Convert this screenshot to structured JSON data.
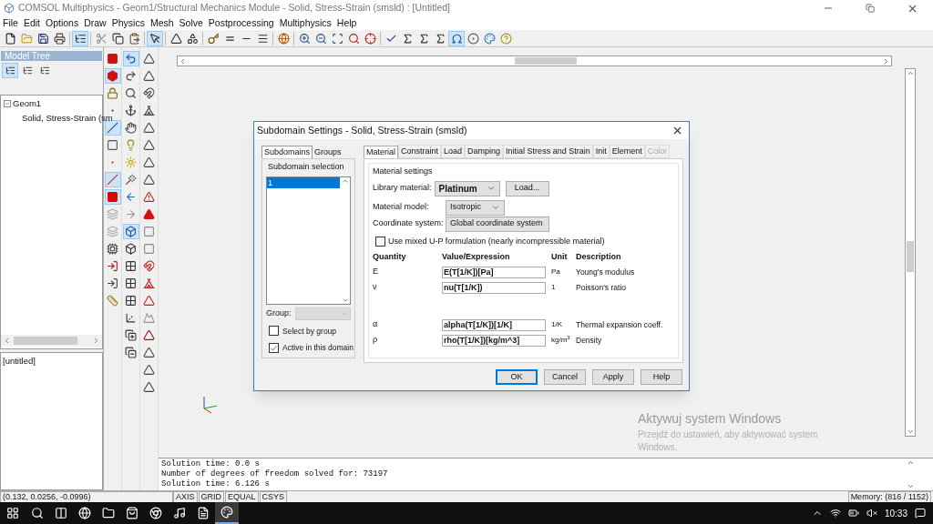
{
  "window": {
    "title": "COMSOL Multiphysics - Geom1/Structural Mechanics Module - Solid, Stress-Strain (smsld) : [Untitled]"
  },
  "menu": [
    "File",
    "Edit",
    "Options",
    "Draw",
    "Physics",
    "Mesh",
    "Solve",
    "Postprocessing",
    "Multiphysics",
    "Help"
  ],
  "toolbar": [
    {
      "selected": false
    },
    {
      "selected": false
    },
    {
      "selected": false
    },
    {
      "selected": false
    },
    {
      "selected": true
    },
    {
      "selected": false
    },
    {
      "selected": false
    },
    {
      "selected": false
    },
    {
      "selected": true
    },
    {
      "selected": false
    },
    {
      "selected": false
    },
    {
      "selected": false
    },
    {
      "selected": false
    },
    {
      "selected": false
    },
    {
      "selected": false
    },
    {
      "selected": false
    },
    {
      "selected": false
    },
    {
      "selected": false
    },
    {
      "selected": false
    },
    {
      "selected": false
    },
    {
      "selected": false
    },
    {
      "selected": false
    },
    {
      "selected": false
    },
    {
      "selected": false
    },
    {
      "selected": false
    },
    {
      "selected": true
    },
    {
      "selected": false
    },
    {
      "selected": false
    },
    {
      "selected": false
    }
  ],
  "model_tree": {
    "title": "Model Tree",
    "tools": [
      {
        "selected": true
      },
      {
        "selected": false
      },
      {
        "selected": false
      }
    ],
    "items": [
      {
        "label": "Geom1",
        "expanded": true,
        "children": [
          {
            "label": "Solid, Stress-Strain (sm"
          }
        ]
      }
    ]
  },
  "notes_panel": {
    "text": "[untitled]"
  },
  "side_toolbars": [
    [
      {
        "selected": false
      },
      {
        "selected": true
      },
      {
        "selected": false
      },
      {
        "selected": false
      },
      {
        "selected": true
      },
      {
        "selected": false
      },
      {
        "selected": false
      },
      {
        "selected": true
      },
      {
        "selected": true
      },
      {
        "selected": false
      },
      {
        "selected": false
      },
      {
        "selected": false
      },
      {
        "selected": false
      },
      {
        "selected": false
      },
      {
        "selected": false
      }
    ],
    [
      {
        "selected": true
      },
      {
        "selected": false
      },
      {
        "selected": false
      },
      {
        "selected": false
      },
      {
        "selected": false
      },
      {
        "selected": false
      },
      {
        "selected": false
      },
      {
        "selected": false
      },
      {
        "selected": false
      },
      {
        "selected": false
      },
      {
        "selected": true
      },
      {
        "selected": false
      },
      {
        "selected": false
      },
      {
        "selected": false
      },
      {
        "selected": false
      },
      {
        "selected": false
      },
      {
        "selected": false
      },
      {
        "selected": false
      }
    ],
    [
      {
        "selected": false
      },
      {
        "selected": false
      },
      {
        "selected": false
      },
      {
        "selected": false
      },
      {
        "selected": false
      },
      {
        "selected": false
      },
      {
        "selected": false
      },
      {
        "selected": false
      },
      {
        "selected": false
      },
      {
        "selected": false
      },
      {
        "selected": false
      },
      {
        "selected": false
      },
      {
        "selected": false
      },
      {
        "selected": false
      },
      {
        "selected": false
      },
      {
        "selected": false
      },
      {
        "selected": false
      },
      {
        "selected": false
      },
      {
        "selected": false
      },
      {
        "selected": false
      }
    ]
  ],
  "dialog": {
    "title": "Subdomain Settings - Solid, Stress-Strain (smsld)",
    "side_tabs": [
      {
        "label": "Subdomains",
        "selected": true
      },
      {
        "label": "Groups",
        "selected": false
      }
    ],
    "subdomain_selection": {
      "title": "Subdomain selection",
      "items": [
        {
          "label": "1",
          "selected": true
        }
      ]
    },
    "group_label": "Group:",
    "checkboxes": [
      {
        "label": "Select by group",
        "checked": false
      },
      {
        "label": "Active in this domain",
        "checked": true
      }
    ],
    "tabs": [
      {
        "label": "Material",
        "selected": true,
        "disabled": false
      },
      {
        "label": "Constraint",
        "selected": false,
        "disabled": false
      },
      {
        "label": "Load",
        "selected": false,
        "disabled": false
      },
      {
        "label": "Damping",
        "selected": false,
        "disabled": false
      },
      {
        "label": "Initial Stress and Strain",
        "selected": false,
        "disabled": false
      },
      {
        "label": "Init",
        "selected": false,
        "disabled": false
      },
      {
        "label": "Element",
        "selected": false,
        "disabled": false
      },
      {
        "label": "Color",
        "selected": false,
        "disabled": true
      }
    ],
    "material_settings": {
      "title": "Material settings",
      "library_material": {
        "label": "Library material:",
        "value": "Platinum"
      },
      "load_button": "Load...",
      "material_model": {
        "label": "Material model:",
        "value": "Isotropic"
      },
      "coordinate_system": {
        "label": "Coordinate system:",
        "value": "Global coordinate system"
      },
      "mixed_formulation": {
        "label": "Use mixed U-P formulation (nearly incompressible material)",
        "checked": false
      },
      "columns": [
        "Quantity",
        "Value/Expression",
        "Unit",
        "Description"
      ],
      "rows": [
        {
          "quantity": "E",
          "value": "E(T[1/K])[Pa]",
          "unit": "Pa",
          "description": "Young's modulus"
        },
        {
          "quantity": "ν",
          "value": "nu(T[1/K])",
          "unit": "1",
          "description": "Poisson's ratio"
        },
        {
          "quantity": "α",
          "value": "alpha(T[1/K])[1/K]",
          "unit": "1/K",
          "description": "Thermal expansion coeff."
        },
        {
          "quantity": "ρ",
          "value": "rho(T[1/K])[kg/m^3]",
          "unit": "kg/m$^{3}$",
          "description": "Density"
        }
      ]
    },
    "buttons": [
      {
        "label": "OK",
        "selected": true
      },
      {
        "label": "Cancel",
        "selected": false
      },
      {
        "label": "Apply",
        "selected": false
      },
      {
        "label": "Help",
        "selected": false
      }
    ]
  },
  "log": [
    "Solution time: 0.0 s",
    "Number of degrees of freedom solved for: 73197",
    "Solution time: 6.126 s"
  ],
  "status_bar": {
    "coordinates": "(0.132, 0.0256, -0.0996)",
    "toggles": [
      "AXIS",
      "GRID",
      "EQUAL",
      "CSYS"
    ],
    "memory": "Memory: (816 / 1152)"
  },
  "activation_notice": {
    "title": "Aktywuj system Windows",
    "text": "Przejdź do ustawień, aby aktywować system Windows."
  },
  "taskbar": {
    "apps": [
      {
        "selected": false
      },
      {
        "selected": false
      },
      {
        "selected": false
      },
      {
        "selected": false
      },
      {
        "selected": false
      },
      {
        "selected": false
      },
      {
        "selected": false
      },
      {
        "selected": false
      },
      {
        "selected": true
      }
    ],
    "time": "10:33"
  }
}
